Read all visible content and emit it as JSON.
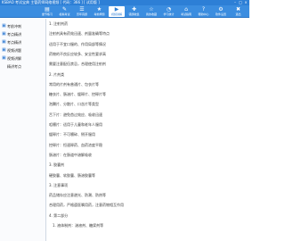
{
  "app": {
    "title": "KSBAO 考试宝典 主管药师网络视频 [ 代码：366 ] [ 试用版 ]"
  },
  "toolbar": {
    "buttons": [
      {
        "label": "章节练习",
        "icon": "▤",
        "active": false
      },
      {
        "label": "模拟考试",
        "icon": "✎",
        "active": false
      },
      {
        "label": "历年真题",
        "icon": "☰",
        "active": false
      },
      {
        "label": "考前押题",
        "icon": "★",
        "active": false
      },
      {
        "label": "视频讲解",
        "icon": "▶",
        "active": true
      },
      {
        "label": "错题收集",
        "icon": "✚",
        "active": false
      },
      {
        "label": "我的收藏",
        "icon": "☆",
        "active": false
      },
      {
        "label": "学习统计",
        "icon": "◔",
        "active": false
      },
      {
        "label": "考试指南",
        "icon": "⌂",
        "active": false
      },
      {
        "label": "帮助中心",
        "icon": "?",
        "active": false
      },
      {
        "label": "软件设置",
        "icon": "⚙",
        "active": false
      },
      {
        "label": "退出",
        "icon": "✖",
        "active": false
      }
    ]
  },
  "sidebar": {
    "items": [
      {
        "label": "考前冲刺",
        "level": 0
      },
      {
        "label": "考点精讲",
        "level": 0
      },
      {
        "label": "考点精讲",
        "level": 0
      },
      {
        "label": "视频讲题",
        "level": 0
      },
      {
        "label": "视频讲解",
        "level": 0
      },
      {
        "label": "精讲考点",
        "level": 1
      }
    ]
  },
  "content": {
    "lines": [
      {
        "text": "1. 注射剂药",
        "indent": false
      },
      {
        "text": "注射剂具有药效迅速、剂量准确等特点",
        "indent": false
      },
      {
        "text": "适用于不宜口服的、作用局部等情况",
        "indent": false
      },
      {
        "text": "药物的不良反应较多、安全性要求高",
        "indent": false
      },
      {
        "text": "需要注意配伍禁忌，合理使用注射剂",
        "indent": false
      },
      {
        "text": "2. 片剂类",
        "indent": false
      },
      {
        "text": "常用的片剂有普通片、包衣片等",
        "indent": false
      },
      {
        "text": "糖衣片、肠溶片、缓释片、控释片等",
        "indent": false
      },
      {
        "text": "泡腾片、分散片、口含片等类型",
        "indent": false
      },
      {
        "text": "舌下片：避免首过效应、吸收迅速",
        "indent": false
      },
      {
        "text": "咀嚼片：适用于儿童和老年人服用",
        "indent": false
      },
      {
        "text": "缓释片：不可嚼碎、掰开服用",
        "indent": false
      },
      {
        "text": "控释片：恒速释药、血药浓度平稳",
        "indent": false
      },
      {
        "text": "肠溶片：在肠道中溶解吸收",
        "indent": false
      },
      {
        "text": "3. 胶囊剂",
        "indent": false
      },
      {
        "text": "硬胶囊、软胶囊、肠溶胶囊等",
        "indent": false
      },
      {
        "text": "3. 注意事项",
        "indent": false
      },
      {
        "text": "药品储存应注意避光、防潮、防热等",
        "indent": false
      },
      {
        "text": "合理用药，严格遵医嘱用药，注意药物相互作用",
        "indent": false
      },
      {
        "text": "4. 第二部分",
        "indent": false
      },
      {
        "text": "1. 液体制剂：溶液剂、糖浆剂等",
        "indent": true
      }
    ]
  }
}
